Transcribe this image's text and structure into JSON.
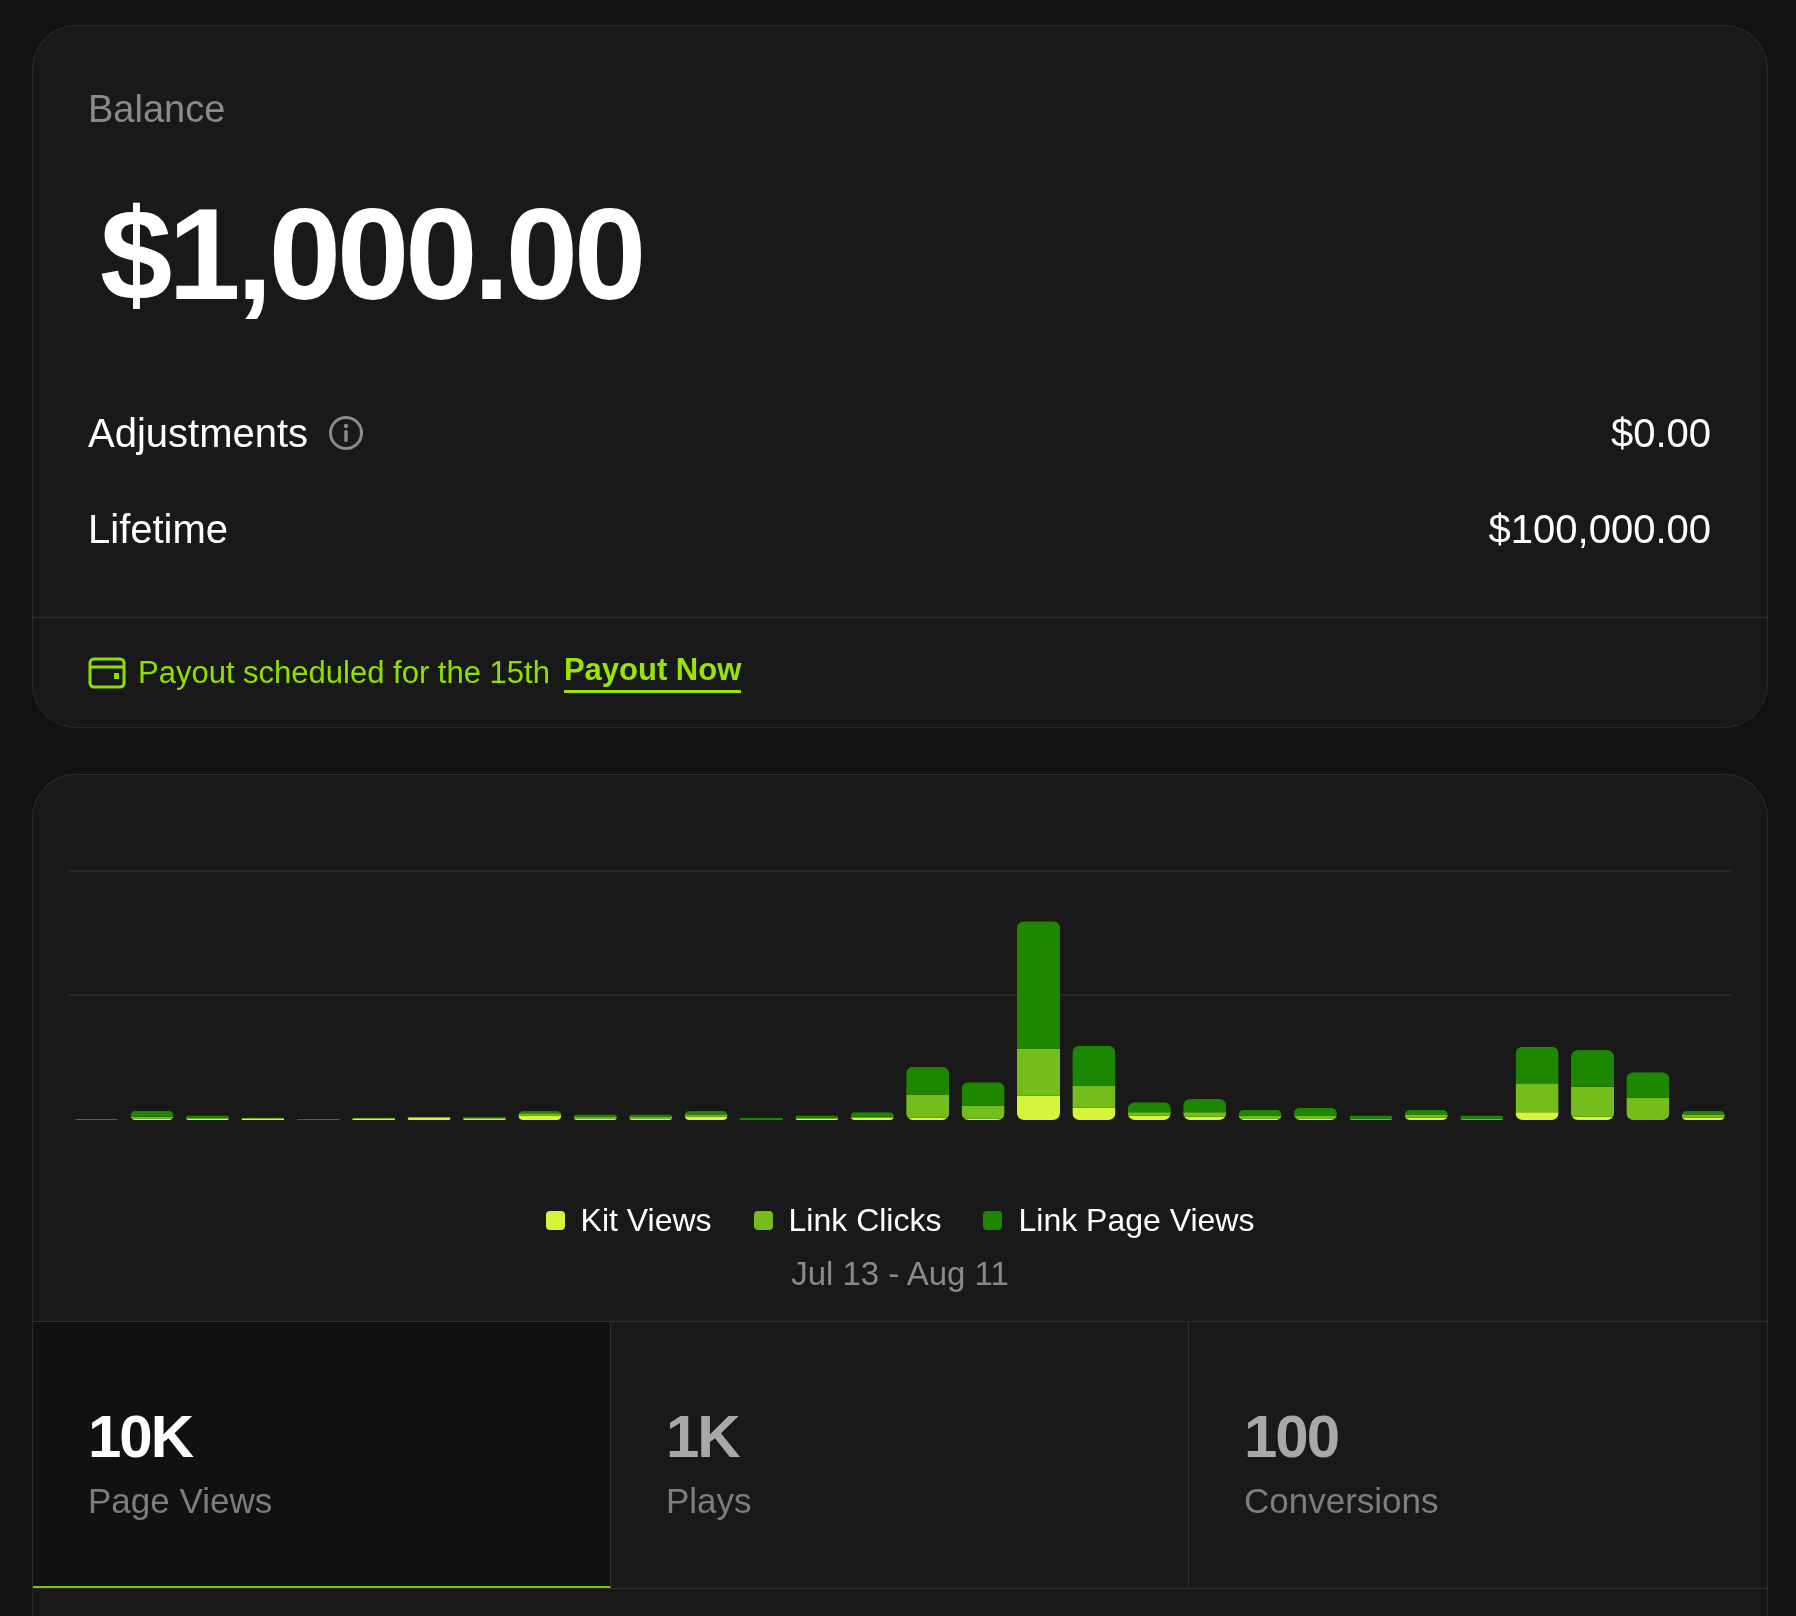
{
  "balance": {
    "label": "Balance",
    "amount": "$1,000.00"
  },
  "rows": [
    {
      "label": "Adjustments",
      "info": true,
      "value": "$0.00"
    },
    {
      "label": "Lifetime",
      "info": false,
      "value": "$100,000.00"
    }
  ],
  "payout": {
    "text": "Payout scheduled for the 15th",
    "link": "Payout Now"
  },
  "chart": {
    "legend": [
      {
        "label": "Kit Views",
        "color": "#d6f53a"
      },
      {
        "label": "Link Clicks",
        "color": "#74bd1a"
      },
      {
        "label": "Link Page Views",
        "color": "#1e8700"
      }
    ],
    "date_range": "Jul 13 - Aug 11"
  },
  "stats": [
    {
      "value": "10K",
      "label": "Page Views",
      "selected": true
    },
    {
      "value": "1K",
      "label": "Plays",
      "selected": false
    },
    {
      "value": "100",
      "label": "Conversions",
      "selected": false
    }
  ]
}
